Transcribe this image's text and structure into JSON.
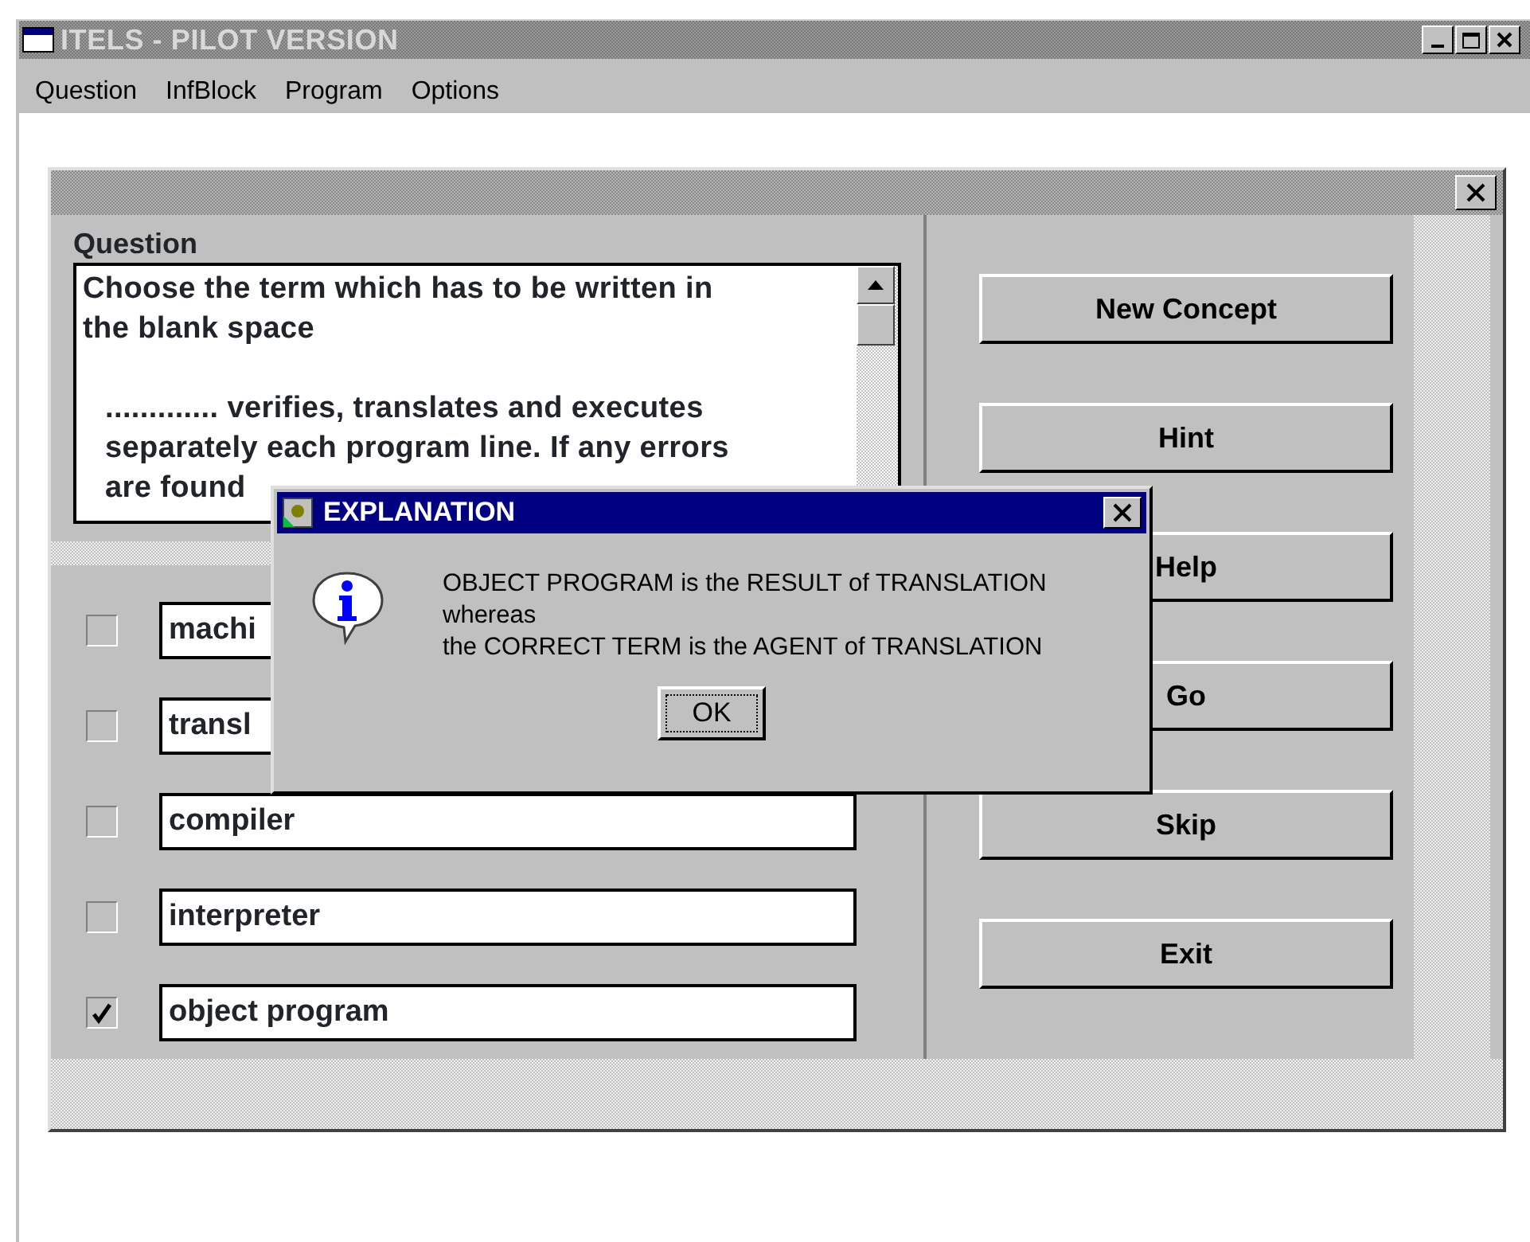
{
  "window": {
    "title": "ITELS - PILOT VERSION"
  },
  "menu": [
    {
      "label": "Question"
    },
    {
      "label": "InfBlock"
    },
    {
      "label": "Program"
    },
    {
      "label": "Options"
    }
  ],
  "question": {
    "label": "Question",
    "paragraphs": [
      "Choose the term which has to be written in the blank space",
      "............. verifies, translates and executes separately each program line. If any errors are found"
    ]
  },
  "options": [
    {
      "text": "machi",
      "checked": false
    },
    {
      "text": "transl",
      "checked": false
    },
    {
      "text": "compiler",
      "checked": false
    },
    {
      "text": "interpreter",
      "checked": false
    },
    {
      "text": "object program",
      "checked": true
    }
  ],
  "buttons": [
    {
      "label": "New Concept"
    },
    {
      "label": "Hint"
    },
    {
      "label": "Help"
    },
    {
      "label": "Go"
    },
    {
      "label": "Skip"
    },
    {
      "label": "Exit"
    }
  ],
  "dialog": {
    "title": "EXPLANATION",
    "message_lines": [
      "OBJECT PROGRAM is the RESULT of TRANSLATION",
      "whereas",
      "the CORRECT TERM is the AGENT of TRANSLATION"
    ],
    "button": "OK"
  }
}
